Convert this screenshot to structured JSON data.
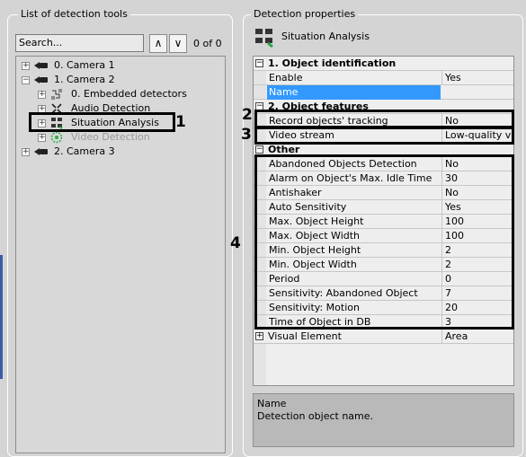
{
  "left_panel": {
    "title": "List of detection tools",
    "search_value": "Search...",
    "up_glyph": "∧",
    "down_glyph": "∨",
    "counter": "0 of 0",
    "tree": [
      {
        "label": "0. Camera 1",
        "icon": "camera-icon"
      },
      {
        "label": "1. Camera 2",
        "icon": "camera-icon"
      },
      {
        "label": "0. Embedded detectors",
        "icon": "embedded-detectors-icon"
      },
      {
        "label": "Audio Detection",
        "icon": "audio-detection-icon"
      },
      {
        "label": "Situation Analysis",
        "icon": "situation-analysis-icon"
      },
      {
        "label": "Video Detection",
        "icon": "video-detection-icon"
      },
      {
        "label": "2. Camera 3",
        "icon": "camera-icon"
      }
    ]
  },
  "right_panel": {
    "title": "Detection properties",
    "header_label": "Situation Analysis",
    "categories": {
      "object_identification": "1. Object identification",
      "object_features": "2. Object features",
      "other": "Other"
    },
    "rows": {
      "enable": {
        "key": "Enable",
        "value": "Yes"
      },
      "name": {
        "key": "Name",
        "value": ""
      },
      "record_tracking": {
        "key": "Record objects' tracking",
        "value": "No"
      },
      "video_stream": {
        "key": "Video stream",
        "value": "Low-quality v"
      },
      "visual_element": {
        "key": "Visual Element",
        "value": "Area"
      }
    },
    "other_rows": [
      {
        "key": "Abandoned Objects Detection",
        "value": "No"
      },
      {
        "key": "Alarm on Object's Max. Idle Time",
        "value": "30"
      },
      {
        "key": "Antishaker",
        "value": "No"
      },
      {
        "key": "Auto Sensitivity",
        "value": "Yes"
      },
      {
        "key": "Max. Object Height",
        "value": "100"
      },
      {
        "key": "Max. Object Width",
        "value": "100"
      },
      {
        "key": "Min. Object Height",
        "value": "2"
      },
      {
        "key": "Min. Object Width",
        "value": "2"
      },
      {
        "key": "Period",
        "value": "0"
      },
      {
        "key": "Sensitivity: Abandoned Object",
        "value": "7"
      },
      {
        "key": "Sensitivity: Motion",
        "value": "20"
      },
      {
        "key": "Time of Object in DB",
        "value": "3"
      }
    ],
    "description_title": "Name",
    "description_text": "Detection object name."
  },
  "callouts": [
    "1",
    "2",
    "3",
    "4"
  ],
  "colors": {
    "background": "#d4d4d4",
    "selection": "#3399ff",
    "description_bg": "#b9b9b9",
    "callout": "#000000"
  }
}
